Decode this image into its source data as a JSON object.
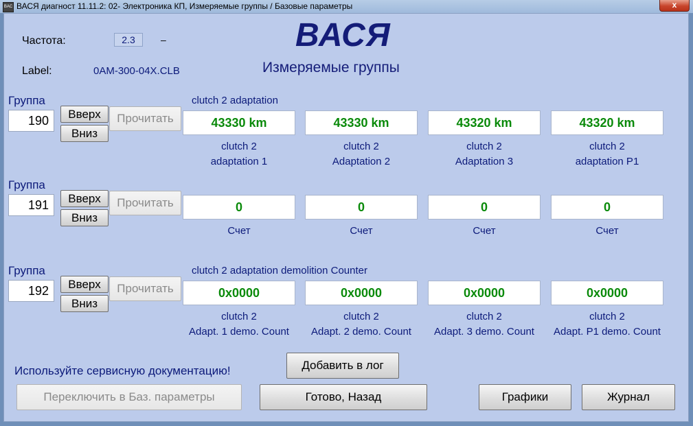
{
  "window": {
    "title": "ВАСЯ диагност 11.11.2: 02- Электроника КП,  Измеряемые группы / Базовые параметры",
    "close_label": "x",
    "icon_text": "BAC"
  },
  "header": {
    "freq_label": "Частота:",
    "freq_value": "2.3",
    "freq_dash": "–",
    "label_label": "Label:",
    "label_value": "0AM-300-04X.CLB",
    "brand": "ВАСЯ",
    "subtitle": "Измеряемые группы"
  },
  "groups": [
    {
      "label": "Группа",
      "number": "190",
      "up": "Вверх",
      "down": "Вниз",
      "read": "Прочитать",
      "title": "clutch 2 adaptation",
      "values": [
        "43330 km",
        "43330 km",
        "43320 km",
        "43320 km"
      ],
      "captions": [
        [
          "clutch 2",
          "adaptation 1"
        ],
        [
          "clutch 2",
          "Adaptation 2"
        ],
        [
          "clutch 2",
          "Adaptation 3"
        ],
        [
          "clutch 2",
          "adaptation P1"
        ]
      ]
    },
    {
      "label": "Группа",
      "number": "191",
      "up": "Вверх",
      "down": "Вниз",
      "read": "Прочитать",
      "title": "",
      "values": [
        "0",
        "0",
        "0",
        "0"
      ],
      "captions": [
        [
          "Счет",
          ""
        ],
        [
          "Счет",
          ""
        ],
        [
          "Счет",
          ""
        ],
        [
          "Счет",
          ""
        ]
      ]
    },
    {
      "label": "Группа",
      "number": "192",
      "up": "Вверх",
      "down": "Вниз",
      "read": "Прочитать",
      "title": "clutch 2 adaptation demolition Counter",
      "values": [
        "0x0000",
        "0x0000",
        "0x0000",
        "0x0000"
      ],
      "captions": [
        [
          "clutch 2",
          "Adapt. 1 demo. Count"
        ],
        [
          "clutch 2",
          "Adapt. 2 demo. Count"
        ],
        [
          "clutch 2",
          "Adapt. 3 demo. Count"
        ],
        [
          "clutch 2",
          "Adapt. P1 demo. Count"
        ]
      ]
    }
  ],
  "footer": {
    "notice": "Используйте сервисную документацию!",
    "add_log": "Добавить в лог",
    "switch_basic": "Переключить в Баз. параметры",
    "done_back": "Готово, Назад",
    "graphs": "Графики",
    "journal": "Журнал"
  },
  "colors": {
    "panel_bg": "#bccbeb",
    "value_text": "#0a8a0a",
    "brand_navy": "#141c78"
  }
}
